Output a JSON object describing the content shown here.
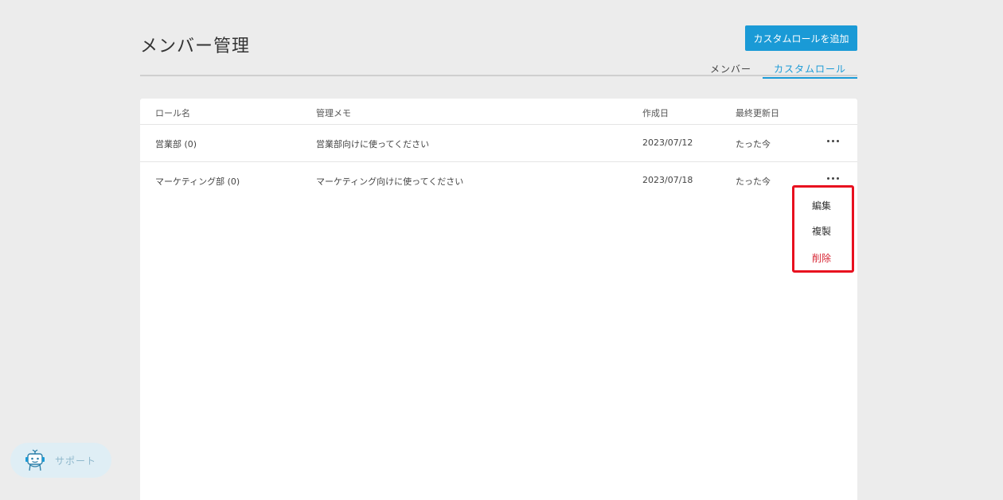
{
  "page": {
    "title": "メンバー管理",
    "add_button_label": "カスタムロールを追加"
  },
  "tabs": [
    {
      "label": "メンバー",
      "active": false
    },
    {
      "label": "カスタムロール",
      "active": true
    }
  ],
  "table": {
    "headers": [
      "ロール名",
      "管理メモ",
      "作成日",
      "最終更新日"
    ],
    "rows": [
      {
        "name": "営業部 (0)",
        "memo": "営業部向けに使ってください",
        "created": "2023/07/12",
        "updated": "たった今"
      },
      {
        "name": "マーケティング部 (0)",
        "memo": "マーケティング向けに使ってください",
        "created": "2023/07/18",
        "updated": "たった今"
      }
    ]
  },
  "context_menu": {
    "items": [
      {
        "label": "編集",
        "danger": false
      },
      {
        "label": "複製",
        "danger": false
      },
      {
        "label": "削除",
        "danger": true
      }
    ]
  },
  "support": {
    "label": "サポート"
  },
  "colors": {
    "accent": "#1a9ad6",
    "danger": "#d72533",
    "highlight": "#e8101f"
  }
}
